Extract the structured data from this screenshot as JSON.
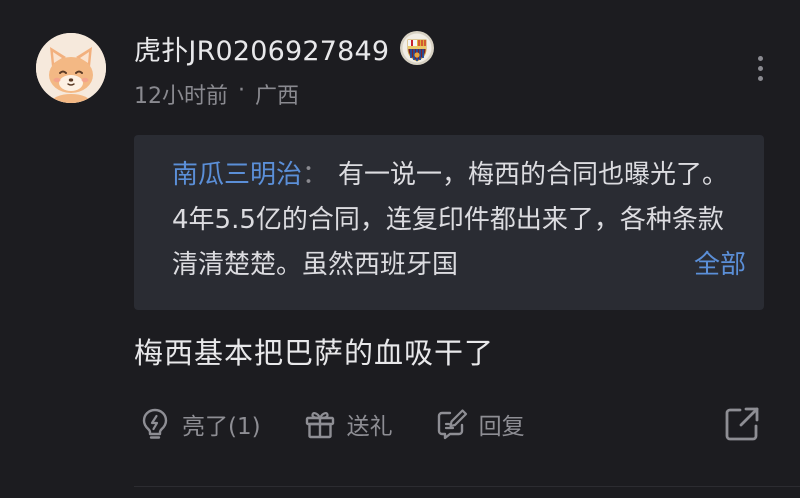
{
  "comment": {
    "username": "虎扑JR0206927849",
    "time": "12小时前",
    "separator": "·",
    "location": "广西",
    "team_badge_icon": "barcelona-crest-icon",
    "avatar_icon": "fox-avatar-icon"
  },
  "quote": {
    "author": "南瓜三明治",
    "colon": "：",
    "text": "有一说一，梅西的合同也曝光了。4年5.5亿的合同，连复印件都出来了，各种条款清清楚楚。虽然西班牙国",
    "more_label": "全部"
  },
  "reply": {
    "text": "梅西基本把巴萨的血吸干了"
  },
  "actions": {
    "like_label": "亮了(1)",
    "gift_label": "送礼",
    "reply_label": "回复"
  },
  "colors": {
    "background": "#1c1c20",
    "quote_background": "#2a2c33",
    "link_blue": "#5b8fd8",
    "muted_text": "#8a8a90"
  }
}
